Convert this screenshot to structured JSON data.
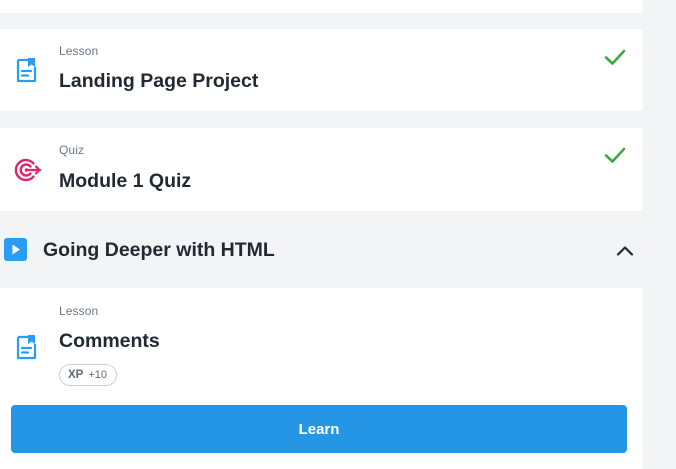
{
  "items": [
    {
      "kicker": "Lesson",
      "title": "Landing Page Project",
      "icon": "lesson-doc-icon",
      "completed": true
    },
    {
      "kicker": "Quiz",
      "title": "Module 1 Quiz",
      "icon": "quiz-target-icon",
      "completed": true
    }
  ],
  "section": {
    "title": "Going Deeper with HTML",
    "icon": "play-icon",
    "expanded": true
  },
  "current": {
    "kicker": "Lesson",
    "title": "Comments",
    "icon": "lesson-doc-icon",
    "xp_label": "XP",
    "xp_value": "+10",
    "button_label": "Learn"
  },
  "colors": {
    "accent": "#2596e6",
    "check": "#3fa83f",
    "quiz": "#e0246b",
    "lesson_icon": "#2a9cf1",
    "background": "#f2f4f6"
  }
}
